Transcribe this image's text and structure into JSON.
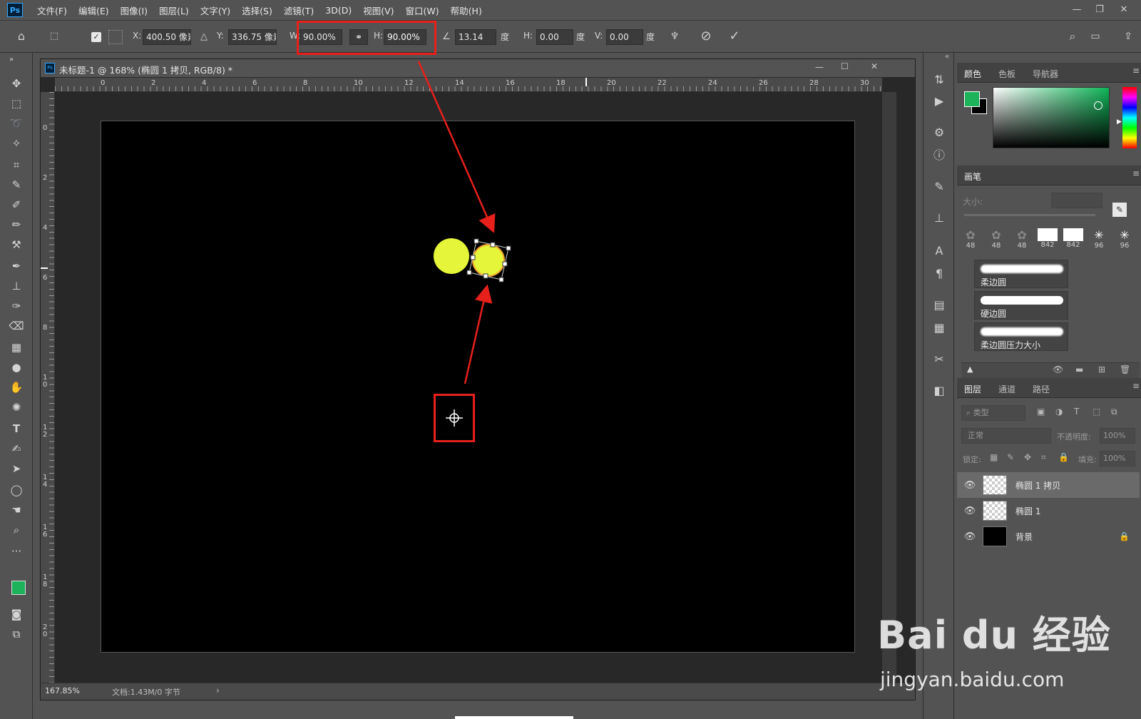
{
  "menus": [
    "文件(F)",
    "编辑(E)",
    "图像(I)",
    "图层(L)",
    "文字(Y)",
    "选择(S)",
    "滤镜(T)",
    "3D(D)",
    "视图(V)",
    "窗口(W)",
    "帮助(H)"
  ],
  "app_logo": "Ps",
  "options": {
    "x_label": "X:",
    "x_value": "400.50 像素",
    "y_label": "Y:",
    "y_value": "336.75 像素",
    "w_label": "W:",
    "w_value": "90.00%",
    "h_label": "H:",
    "h_value": "90.00%",
    "angle_value": "13.14",
    "angle_unit": "度",
    "hskew_label": "H:",
    "hskew_value": "0.00",
    "hskew_unit": "度",
    "vskew_label": "V:",
    "vskew_value": "0.00",
    "vskew_unit": "度"
  },
  "document": {
    "title": "未标题-1 @ 168% (椭圆 1 拷贝, RGB/8) *",
    "zoom": "167.85%",
    "doc_info": "文档:1.43M/0 字节",
    "hruler_labels": [
      "0",
      "2",
      "4",
      "6",
      "8",
      "10",
      "12",
      "14",
      "16",
      "18",
      "20",
      "22",
      "24",
      "26",
      "28",
      "30"
    ],
    "vruler_labels": [
      "0",
      "2",
      "4",
      "6",
      "8",
      "1 0",
      "1 2",
      "1 4",
      "1 6",
      "1 8",
      "2 0"
    ]
  },
  "panels": {
    "color_tabs": [
      "颜色",
      "色板",
      "导航器"
    ],
    "brush_tab": "画笔",
    "brush_size_label": "大小:",
    "brush_sizes": [
      "48",
      "48",
      "48",
      "842",
      "842",
      "96",
      "96"
    ],
    "brush_presets": [
      "柔边圆",
      "硬边圆",
      "柔边圆压力大小"
    ],
    "layers_tabs": [
      "图层",
      "通道",
      "路径"
    ],
    "kind_filter": "类型",
    "blend_mode": "正常",
    "opacity_label": "不透明度:",
    "opacity_value": "100%",
    "lock_label": "锁定:",
    "fill_label": "填充:",
    "fill_value": "100%",
    "layers": [
      {
        "name": "椭圆 1 拷贝",
        "selected": true
      },
      {
        "name": "椭圆 1",
        "selected": false
      },
      {
        "name": "背景",
        "selected": false
      }
    ]
  },
  "watermark": {
    "brand": "Bai du 经验",
    "url": "jingyan.baidu.com"
  },
  "colors": {
    "foreground": "#1db35b",
    "circle": "#e5f53a",
    "highlight": "#e8201c",
    "selected_layer": "#6a6a6a"
  }
}
